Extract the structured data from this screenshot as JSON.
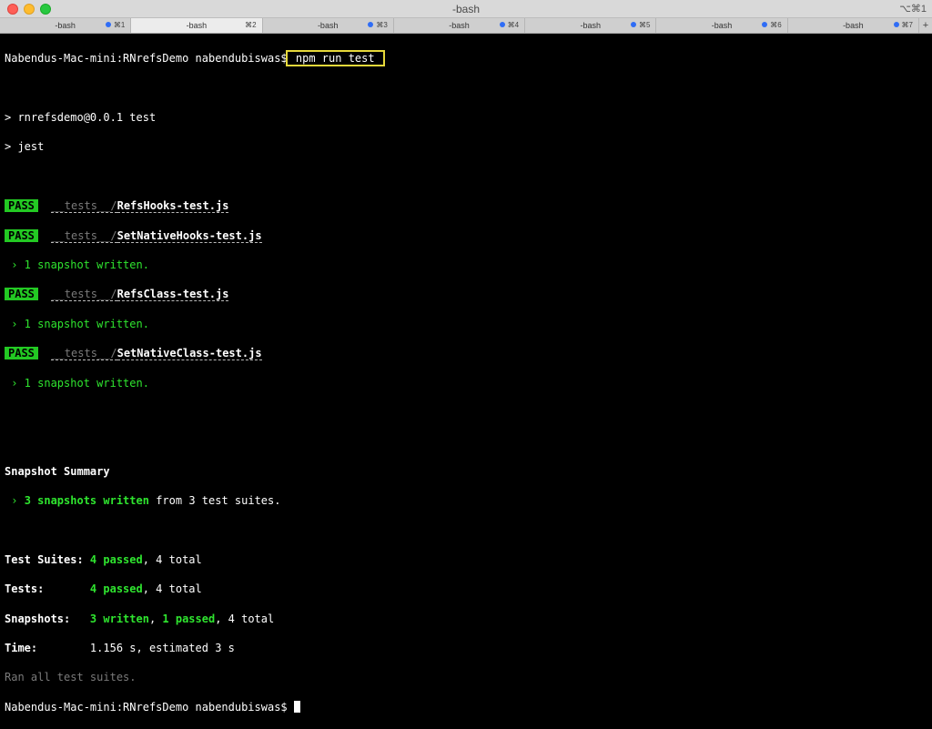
{
  "window": {
    "title": "-bash",
    "shortcut": "⌥⌘1"
  },
  "tabs": [
    {
      "label": "-bash",
      "key": "⌘1",
      "dot": true
    },
    {
      "label": "-bash",
      "key": "⌘2",
      "dot": false
    },
    {
      "label": "-bash",
      "key": "⌘3",
      "dot": true
    },
    {
      "label": "-bash",
      "key": "⌘4",
      "dot": true
    },
    {
      "label": "-bash",
      "key": "⌘5",
      "dot": true
    },
    {
      "label": "-bash",
      "key": "⌘6",
      "dot": true
    },
    {
      "label": "-bash",
      "key": "⌘7",
      "dot": true
    }
  ],
  "tab_add": "+",
  "terminal": {
    "prompt": "Nabendus-Mac-mini:RNrefsDemo nabendubiswas$",
    "command": "npm run test",
    "script_line1": "> rnrefsdemo@0.0.1 test",
    "script_line2": "> jest",
    "pass_label": "PASS",
    "tests_dir": "__tests__/",
    "files": [
      "RefsHooks-test.js",
      "SetNativeHooks-test.js",
      "RefsClass-test.js",
      "SetNativeClass-test.js"
    ],
    "snapshot_written": " › 1 snapshot written.",
    "summary_title": "Snapshot Summary",
    "summary_prefix": " › ",
    "summary_highlight": "3 snapshots written",
    "summary_rest": " from 3 test suites.",
    "suites_label": "Test Suites: ",
    "suites_passed": "4 passed",
    "suites_total": ", 4 total",
    "tests_label": "Tests:       ",
    "tests_passed": "4 passed",
    "tests_total": ", 4 total",
    "snapshots_label": "Snapshots:   ",
    "snapshots_written": "3 written",
    "snapshots_sep": ", ",
    "snapshots_passed": "1 passed",
    "snapshots_total": ", 4 total",
    "time_label": "Time:        ",
    "time_value": "1.156 s, estimated 3 s",
    "ran_all": "Ran all test suites."
  },
  "colors": {
    "pass_bg": "#23c923",
    "highlight_border": "#e6d83a",
    "accent_green": "#2fe52f",
    "tab_dot": "#2f6df6"
  }
}
